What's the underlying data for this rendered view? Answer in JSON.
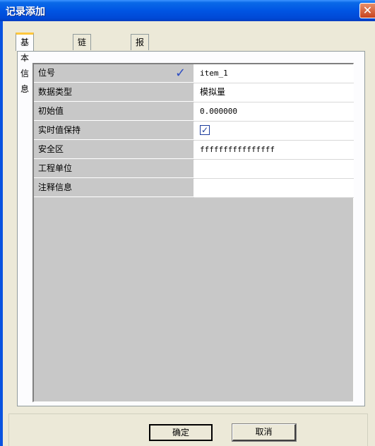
{
  "window": {
    "title": "记录添加",
    "close_symbol": "✕"
  },
  "tabs": [
    {
      "label": "基本信息",
      "active": true
    },
    {
      "label": "链接信息",
      "active": false
    },
    {
      "label": "报警信息",
      "active": false
    }
  ],
  "properties": [
    {
      "label": "位号",
      "value": "item_1",
      "icon": "checkmark-icon"
    },
    {
      "label": "数据类型",
      "value": "模拟量"
    },
    {
      "label": "初始值",
      "value": "0.000000"
    },
    {
      "label": "实时值保持",
      "value": "",
      "checked": true
    },
    {
      "label": "安全区",
      "value": "ffffffffffffffff"
    },
    {
      "label": "工程单位",
      "value": ""
    },
    {
      "label": "注释信息",
      "value": ""
    }
  ],
  "buttons": {
    "ok_label": "确定",
    "cancel_label": "取消"
  },
  "colors": {
    "titlebar": "#0055E3",
    "dialog_bg": "#ECE9D8",
    "grid_bg": "#C8C8C8",
    "tab_highlight": "#FFC73C"
  }
}
